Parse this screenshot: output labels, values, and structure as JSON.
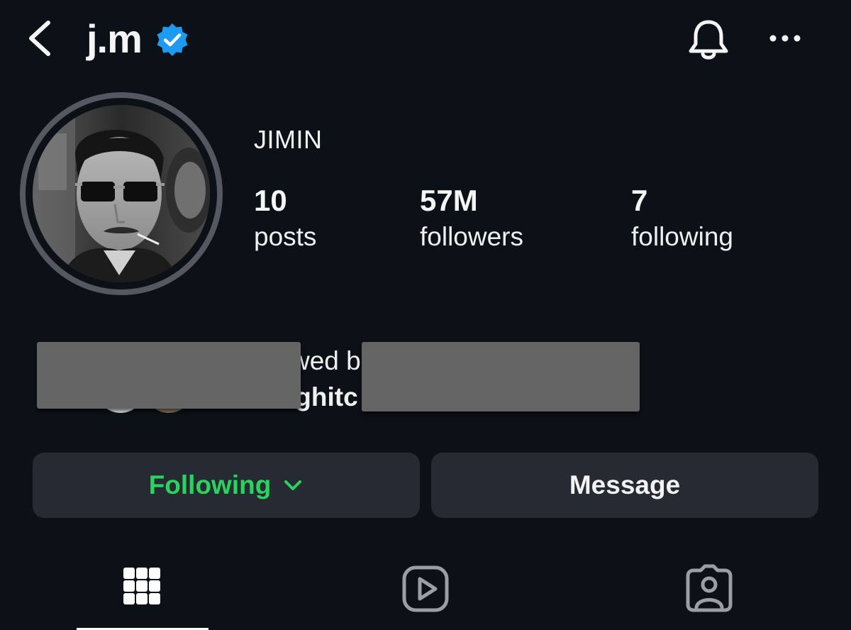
{
  "header": {
    "username": "j.m",
    "verified": true,
    "icons": {
      "back": "chevron-left-icon",
      "verified": "verified-badge-icon",
      "notifications": "bell-icon",
      "more": "more-dots-icon"
    }
  },
  "profile": {
    "display_name": "JIMIN",
    "stats": [
      {
        "value": "10",
        "label": "posts"
      },
      {
        "value": "57M",
        "label": "followers"
      },
      {
        "value": "7",
        "label": "following"
      }
    ],
    "followed_by": {
      "line1_fragment": "wed b",
      "line2_fragment": "ighitc"
    }
  },
  "actions": {
    "following_label": "Following",
    "message_label": "Message"
  },
  "tabs": [
    {
      "icon": "grid-icon",
      "active": true
    },
    {
      "icon": "reels-play-icon",
      "active": false
    },
    {
      "icon": "tagged-person-icon",
      "active": false
    }
  ],
  "colors": {
    "background": "#0c1017",
    "button_bg": "#262a33",
    "following_green": "#2bd35c",
    "verified_blue": "#1d9bf0",
    "redaction_gray": "#646464"
  }
}
